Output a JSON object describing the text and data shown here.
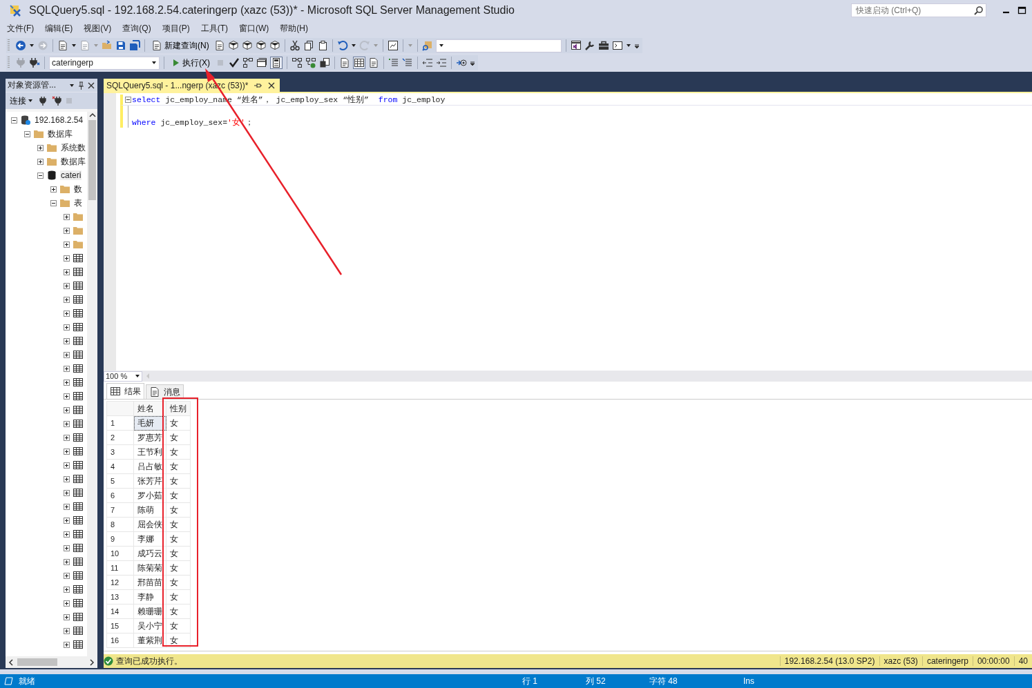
{
  "window": {
    "title": "SQLQuery5.sql - 192.168.2.54.cateringerp (xazc (53))* - Microsoft SQL Server Management Studio"
  },
  "quick_launch": {
    "placeholder": "快速启动 (Ctrl+Q)"
  },
  "menu": [
    "文件(F)",
    "编辑(E)",
    "视图(V)",
    "查询(Q)",
    "项目(P)",
    "工具(T)",
    "窗口(W)",
    "帮助(H)"
  ],
  "toolbar": {
    "new_query": "新建查询(N)",
    "database": "cateringerp",
    "execute": "执行(X)"
  },
  "object_explorer": {
    "title": "对象资源管...",
    "connect": "连接",
    "tree": [
      {
        "label": "192.168.2.54",
        "kind": "server",
        "expanded": true,
        "children": [
          {
            "label": "数据库",
            "kind": "folder",
            "expanded": true,
            "children": [
              {
                "label": "系统数",
                "kind": "folder",
                "expanded": false
              },
              {
                "label": "数据库",
                "kind": "folder",
                "expanded": false
              },
              {
                "label": "cateri",
                "kind": "database",
                "expanded": true,
                "children": [
                  {
                    "label": "数",
                    "kind": "folder",
                    "expanded": false
                  },
                  {
                    "label": "表",
                    "kind": "folder",
                    "expanded": true,
                    "children": [
                      {
                        "kind": "folder",
                        "expanded": false
                      },
                      {
                        "kind": "folder",
                        "expanded": false
                      },
                      {
                        "kind": "folder",
                        "expanded": false
                      },
                      {
                        "kind": "table",
                        "expanded": false
                      },
                      {
                        "kind": "table",
                        "expanded": false
                      },
                      {
                        "kind": "table",
                        "expanded": false
                      },
                      {
                        "kind": "table",
                        "expanded": false
                      },
                      {
                        "kind": "table",
                        "expanded": false
                      },
                      {
                        "kind": "table",
                        "expanded": false
                      },
                      {
                        "kind": "table",
                        "expanded": false
                      },
                      {
                        "kind": "table",
                        "expanded": false
                      },
                      {
                        "kind": "table",
                        "expanded": false
                      },
                      {
                        "kind": "table",
                        "expanded": false
                      },
                      {
                        "kind": "table",
                        "expanded": false
                      },
                      {
                        "kind": "table",
                        "expanded": false
                      },
                      {
                        "kind": "table",
                        "expanded": false
                      },
                      {
                        "kind": "table",
                        "expanded": false
                      },
                      {
                        "kind": "table",
                        "expanded": false
                      },
                      {
                        "kind": "table",
                        "expanded": false
                      },
                      {
                        "kind": "table",
                        "expanded": false
                      },
                      {
                        "kind": "table",
                        "expanded": false
                      },
                      {
                        "kind": "table",
                        "expanded": false
                      },
                      {
                        "kind": "table",
                        "expanded": false
                      },
                      {
                        "kind": "table",
                        "expanded": false
                      },
                      {
                        "kind": "table",
                        "expanded": false
                      },
                      {
                        "kind": "table",
                        "expanded": false
                      },
                      {
                        "kind": "table",
                        "expanded": false
                      },
                      {
                        "kind": "table",
                        "expanded": false
                      },
                      {
                        "kind": "table",
                        "expanded": false
                      },
                      {
                        "kind": "table",
                        "expanded": false
                      },
                      {
                        "kind": "table",
                        "expanded": false
                      },
                      {
                        "kind": "table",
                        "expanded": false
                      }
                    ]
                  }
                ]
              }
            ]
          }
        ]
      }
    ]
  },
  "editor": {
    "tab": {
      "title": "SQLQuery5.sql - 1...ngerp (xazc (53))*",
      "selected": true
    },
    "lines": [
      {
        "fold": true,
        "tokens": [
          {
            "kind": "keyword",
            "text": "select"
          },
          {
            "kind": "plain",
            "text": " jc_employ_name “姓名”， jc_employ_sex “性别”  "
          },
          {
            "kind": "keyword",
            "text": "from"
          },
          {
            "kind": "plain",
            "text": " jc_employ"
          }
        ]
      },
      {
        "fold": false
      },
      {
        "fold": false,
        "tokens": [
          {
            "kind": "keyword",
            "text": "where"
          },
          {
            "kind": "plain",
            "text": " jc_employ_sex="
          },
          {
            "kind": "string",
            "text": "'女'"
          },
          {
            "kind": "plain",
            "text": "；"
          }
        ]
      }
    ],
    "zoom": "100 %"
  },
  "results": {
    "tabs": [
      {
        "label": "结果",
        "selected": true
      },
      {
        "label": "消息",
        "selected": false
      }
    ],
    "columns": [
      "姓名",
      "性别"
    ],
    "rows": [
      {
        "number": "1",
        "cells": [
          "毛妍",
          "女"
        ],
        "selected": true
      },
      {
        "number": "2",
        "cells": [
          "罗惠芳",
          "女"
        ],
        "selected": false
      },
      {
        "number": "3",
        "cells": [
          "王节利",
          "女"
        ],
        "selected": false
      },
      {
        "number": "4",
        "cells": [
          "吕占敏",
          "女"
        ],
        "selected": false
      },
      {
        "number": "5",
        "cells": [
          "张芳芹",
          "女"
        ],
        "selected": false
      },
      {
        "number": "6",
        "cells": [
          "罗小茹",
          "女"
        ],
        "selected": false
      },
      {
        "number": "7",
        "cells": [
          "陈萌",
          "女"
        ],
        "selected": false
      },
      {
        "number": "8",
        "cells": [
          "屈会侠",
          "女"
        ],
        "selected": false
      },
      {
        "number": "9",
        "cells": [
          "李娜",
          "女"
        ],
        "selected": false
      },
      {
        "number": "10",
        "cells": [
          "成巧云",
          "女"
        ],
        "selected": false
      },
      {
        "number": "11",
        "cells": [
          "陈菊菊",
          "女"
        ],
        "selected": false
      },
      {
        "number": "12",
        "cells": [
          "邢苗苗",
          "女"
        ],
        "selected": false
      },
      {
        "number": "13",
        "cells": [
          "李静",
          "女"
        ],
        "selected": false
      },
      {
        "number": "14",
        "cells": [
          "赖珊珊",
          "女"
        ],
        "selected": false
      },
      {
        "number": "15",
        "cells": [
          "吴小宁",
          "女"
        ],
        "selected": false
      },
      {
        "number": "16",
        "cells": [
          "董紫荆",
          "女"
        ],
        "selected": false
      }
    ]
  },
  "query_status": {
    "message": "查询已成功执行。",
    "server": "192.168.2.54 (13.0 SP2)",
    "user": "xazc (53)",
    "database": "cateringerp",
    "elapsed": "00:00:00",
    "rows": "40"
  },
  "status_bar": {
    "state": "就绪",
    "line": "行 1",
    "column": "列 52",
    "char": "字符 48",
    "mode": "Ins"
  }
}
